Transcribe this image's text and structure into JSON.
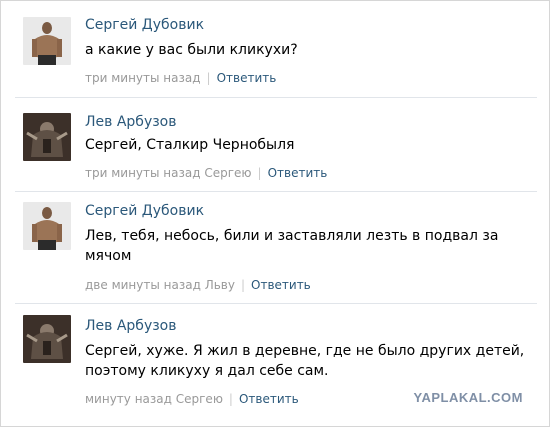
{
  "comments": [
    {
      "author": "Сергей Дубовик",
      "text": "а какие у вас были кликухи?",
      "time": "три минуты назад",
      "reply": "Ответить",
      "avatar": "man-back-avatar-icon"
    },
    {
      "author": "Лев Арбузов",
      "text": "Сергей, Сталкир Чернобыля",
      "time": "три минуты назад Сергею",
      "reply": "Ответить",
      "avatar": "armored-figure-avatar-icon"
    },
    {
      "author": "Сергей Дубовик",
      "text": "Лев, тебя, небось, били и заставляли лезть в подвал за мячом",
      "time": "две минуты назад Льву",
      "reply": "Ответить",
      "avatar": "man-back-avatar-icon"
    },
    {
      "author": "Лев Арбузов",
      "text": "Сергей, хуже. Я жил в деревне, где не было других детей, поэтому кликуху я дал себе сам.",
      "time": "минуту назад Сергею",
      "reply": "Ответить",
      "avatar": "armored-figure-avatar-icon"
    }
  ],
  "watermark": "YAPLAKAL.COM",
  "colors": {
    "author": "#2b587a",
    "meta": "#999999",
    "divider": "#e1e5ea"
  }
}
